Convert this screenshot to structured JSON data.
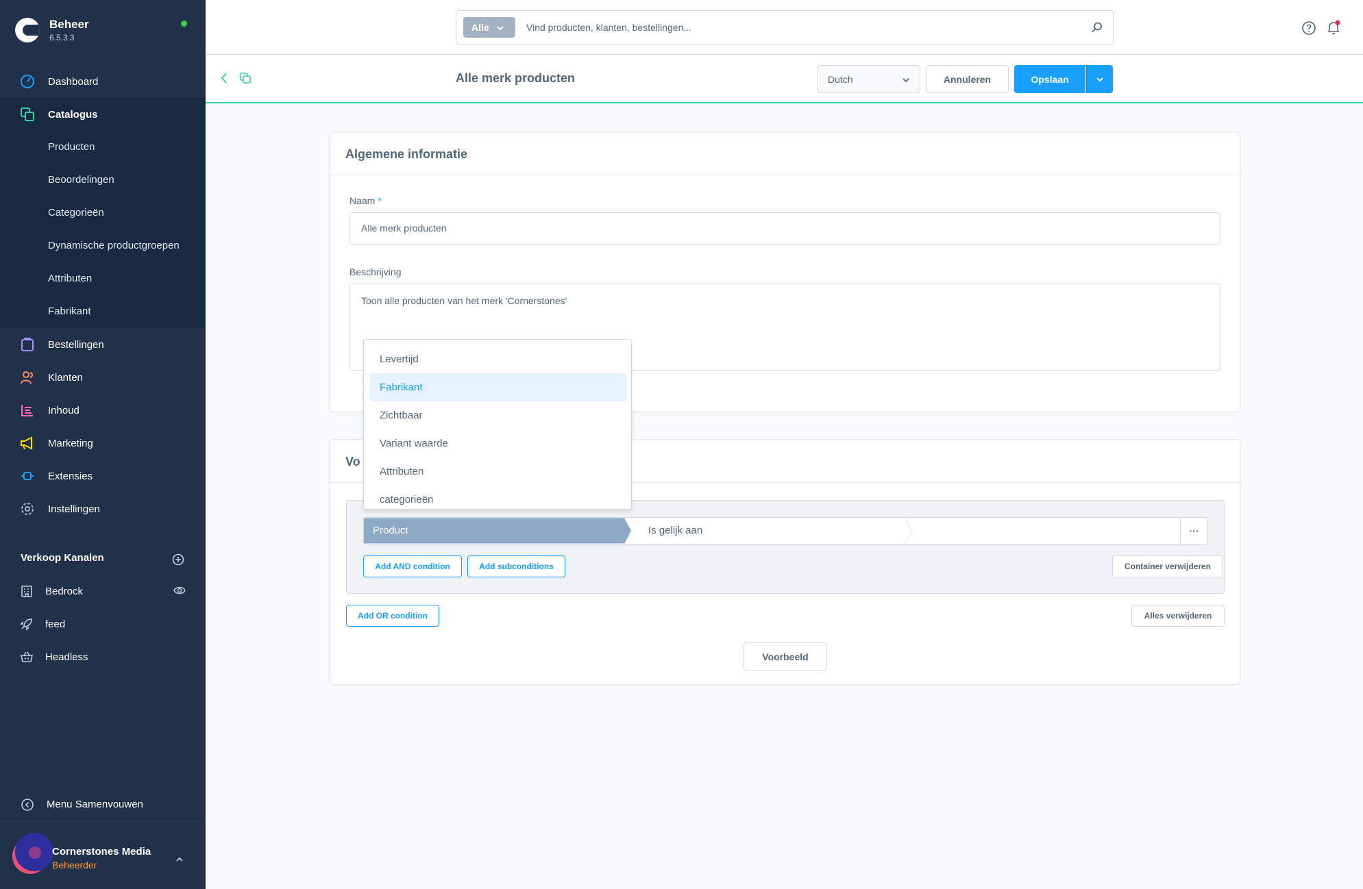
{
  "app": {
    "name": "Beheer",
    "version": "6.5.3.3"
  },
  "sidebar": {
    "items": [
      {
        "label": "Dashboard",
        "icon": "dashboard-icon"
      },
      {
        "label": "Catalogus",
        "icon": "catalog-icon"
      },
      {
        "label": "Bestellingen",
        "icon": "orders-icon"
      },
      {
        "label": "Klanten",
        "icon": "customers-icon"
      },
      {
        "label": "Inhoud",
        "icon": "content-icon"
      },
      {
        "label": "Marketing",
        "icon": "marketing-icon"
      },
      {
        "label": "Extensies",
        "icon": "extensions-icon"
      },
      {
        "label": "Instellingen",
        "icon": "settings-icon"
      }
    ],
    "catalog_children": [
      "Producten",
      "Beoordelingen",
      "Categorieën",
      "Dynamische productgroepen",
      "Attributen",
      "Fabrikant"
    ],
    "channels_title": "Verkoop Kanalen",
    "channels": [
      {
        "label": "Bedrock",
        "icon": "storefront-icon"
      },
      {
        "label": "feed",
        "icon": "rocket-icon"
      },
      {
        "label": "Headless",
        "icon": "basket-icon"
      }
    ],
    "collapse_label": "Menu Samenvouwen",
    "user": {
      "name": "Cornerstones Media",
      "role": "Beheerder"
    }
  },
  "topbar": {
    "search_type": "Alle",
    "search_placeholder": "Vind producten, klanten, bestellingen..."
  },
  "smartbar": {
    "title": "Alle merk producten",
    "language": "Dutch",
    "cancel_label": "Annuleren",
    "save_label": "Opslaan"
  },
  "general": {
    "title": "Algemene informatie",
    "name_label": "Naam",
    "name_required": "*",
    "name_value": "Alle merk producten",
    "description_label": "Beschrijving",
    "description_value": "Toon alle producten van het merk 'Cornerstones'"
  },
  "conditions": {
    "title_visible": "Vo",
    "field_value": "Product",
    "operator_value": "Is gelijk aan",
    "more_label": "···",
    "add_and_label": "Add AND condition",
    "add_sub_label": "Add subconditions",
    "remove_container_label": "Container verwijderen",
    "add_or_label": "Add OR condition",
    "remove_all_label": "Alles verwijderen",
    "preview_label": "Voorbeeld"
  },
  "dropdown": {
    "options": [
      "Levertijd",
      "Fabrikant",
      "Zichtbaar",
      "Variant waarde",
      "Attributen",
      "categorieën"
    ],
    "highlighted": "Fabrikant"
  },
  "colors": {
    "sidebar": "#203149",
    "primary": "#189eff",
    "accent_green": "#37d0a1",
    "field_highlight": "#8ea9c3"
  }
}
